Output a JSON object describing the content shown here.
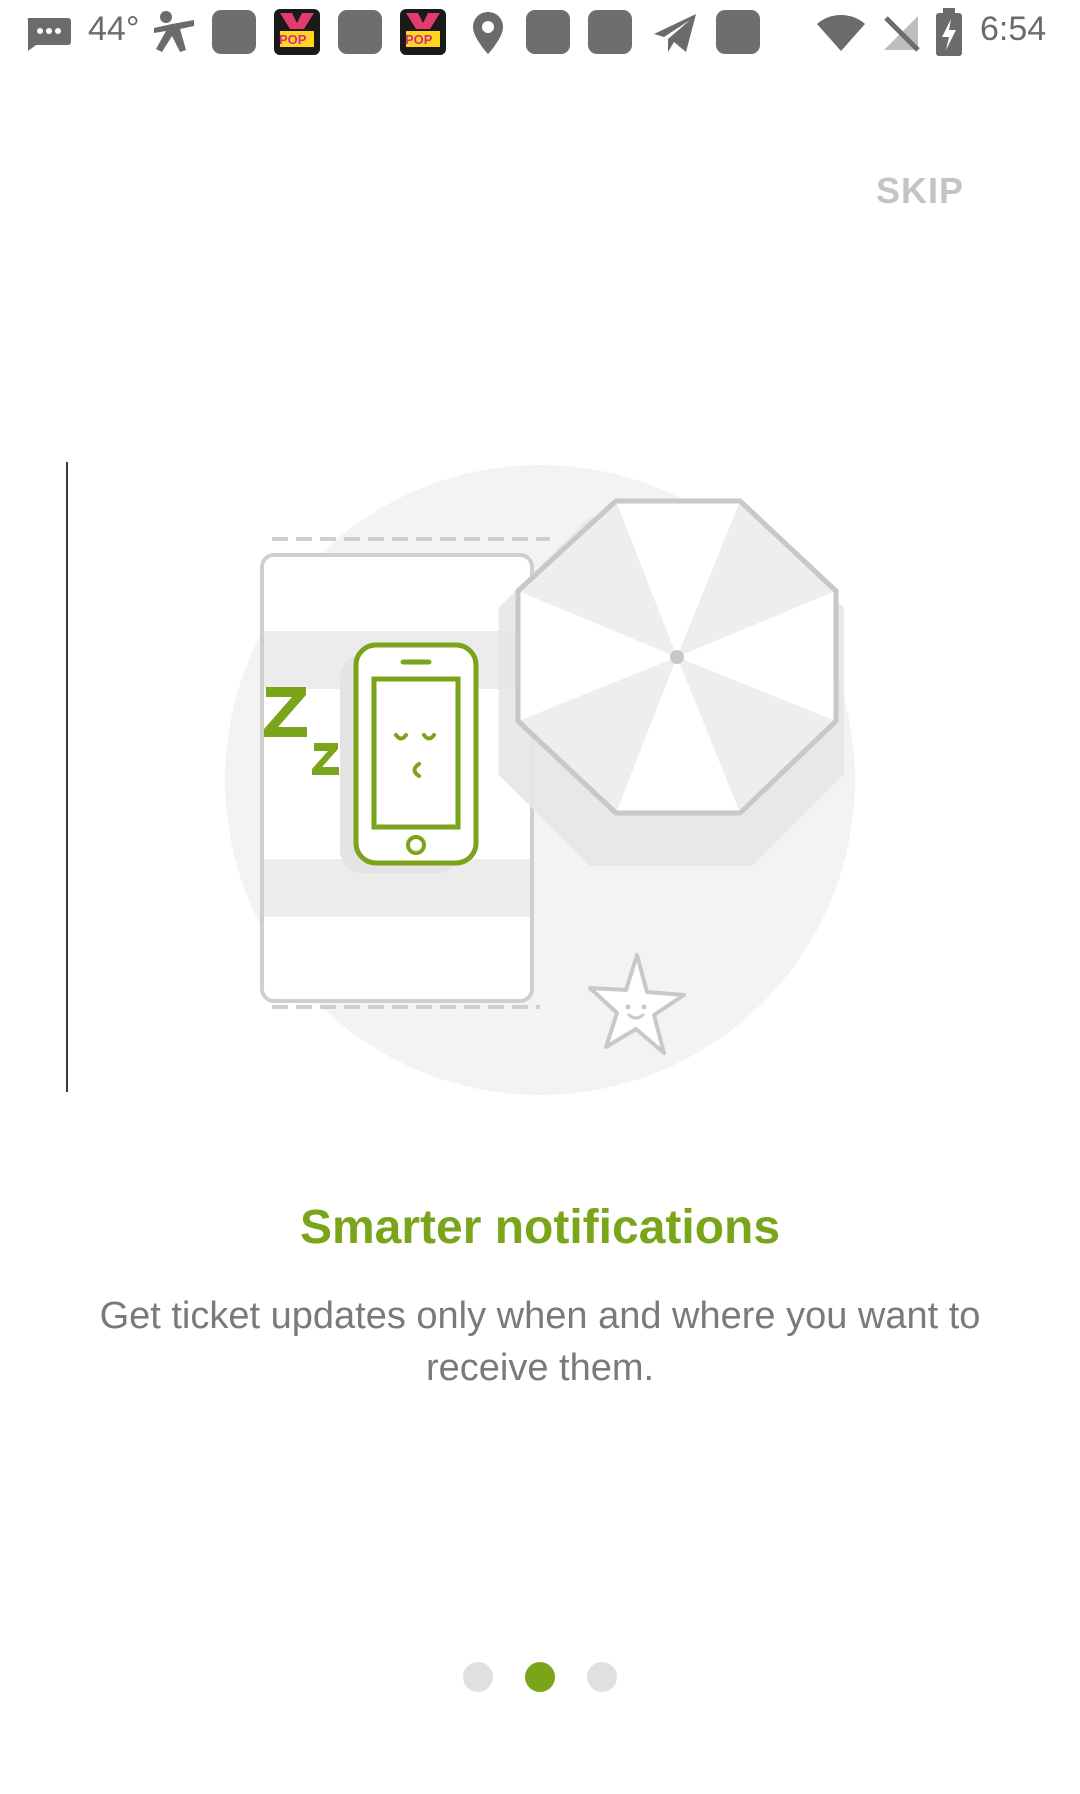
{
  "status_bar": {
    "temperature": "44°",
    "time": "6:54",
    "kpop_label": "POP",
    "icons": [
      "messages-icon",
      "temperature-text",
      "accessibility-icon",
      "app-icon",
      "kpop-app-icon",
      "app-icon",
      "kpop-app-icon",
      "location-pin-icon",
      "app-icon",
      "app-icon",
      "send-icon",
      "app-icon",
      "wifi-icon",
      "no-signal-icon",
      "battery-charging-icon"
    ]
  },
  "onboarding": {
    "skip_label": "SKIP",
    "title": "Smarter notifications",
    "description": "Get ticket updates only when and where you want to receive them.",
    "current_page": 2,
    "total_pages": 3
  },
  "colors": {
    "accent": "#7aa51a",
    "skip": "#c4c4c4",
    "text_secondary": "#7a7a7a",
    "dot_inactive": "#e0e0e0"
  }
}
